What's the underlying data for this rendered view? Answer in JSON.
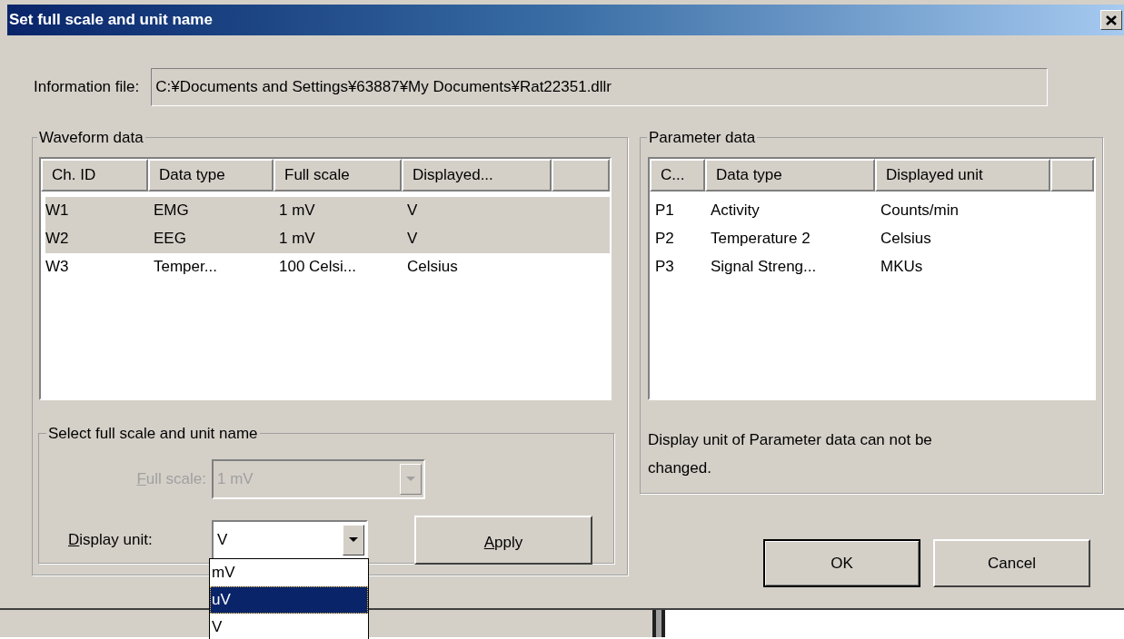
{
  "window": {
    "title": "Set full scale and unit name"
  },
  "information_file": {
    "label": "Information file:",
    "value": "C:¥Documents and Settings¥63887¥My Documents¥Rat22351.dllr"
  },
  "waveform_data": {
    "title": "Waveform data",
    "columns": [
      "Ch. ID",
      "Data type",
      "Full scale",
      "Displayed..."
    ],
    "rows": [
      {
        "cells": [
          "W1",
          "EMG",
          "1 mV",
          "V"
        ],
        "selected": true
      },
      {
        "cells": [
          "W2",
          "EEG",
          "1 mV",
          "V"
        ],
        "selected": true
      },
      {
        "cells": [
          "W3",
          "Temper...",
          "100 Celsi...",
          "Celsius"
        ],
        "selected": false
      }
    ],
    "select_group": {
      "title": "Select full scale and unit name",
      "full_scale": {
        "label": "Full scale:",
        "mnemonic_underlined": true,
        "value": "1 mV",
        "disabled": true
      },
      "display_unit": {
        "label": "Display unit:",
        "mnemonic_underlined": true,
        "value": "V",
        "disabled": false,
        "expanded": true,
        "options": [
          {
            "label": "mV",
            "highlighted": false
          },
          {
            "label": "uV",
            "highlighted": true
          },
          {
            "label": "V",
            "highlighted": false
          }
        ]
      },
      "apply_button": {
        "label": "Apply",
        "mnemonic_underlined": true
      }
    }
  },
  "parameter_data": {
    "title": "Parameter data",
    "columns": [
      "C...",
      "Data type",
      "Displayed unit"
    ],
    "rows": [
      {
        "cells": [
          "P1",
          "Activity",
          "Counts/min"
        ]
      },
      {
        "cells": [
          "P2",
          "Temperature 2",
          "Celsius"
        ]
      },
      {
        "cells": [
          "P3",
          "Signal Streng...",
          "MKUs"
        ]
      }
    ],
    "note": "Display unit of Parameter data can not be changed."
  },
  "buttons": [
    {
      "label": "OK",
      "kind": "default"
    },
    {
      "label": "Cancel",
      "kind": "normal"
    }
  ]
}
